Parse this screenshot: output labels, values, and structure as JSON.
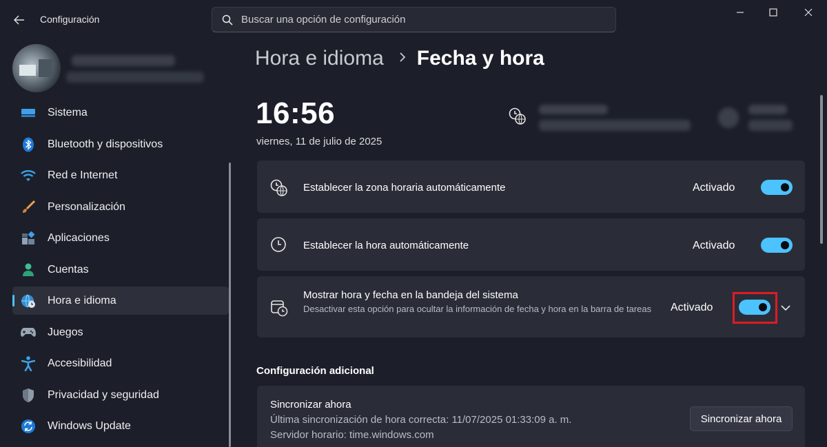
{
  "window": {
    "title": "Configuración",
    "search_placeholder": "Buscar una opción de configuración"
  },
  "sidebar": {
    "items": [
      {
        "label": "Sistema",
        "icon": "monitor-icon"
      },
      {
        "label": "Bluetooth y dispositivos",
        "icon": "bluetooth-icon"
      },
      {
        "label": "Red e Internet",
        "icon": "wifi-icon"
      },
      {
        "label": "Personalización",
        "icon": "paintbrush-icon"
      },
      {
        "label": "Aplicaciones",
        "icon": "apps-icon"
      },
      {
        "label": "Cuentas",
        "icon": "person-icon"
      },
      {
        "label": "Hora e idioma",
        "icon": "globe-clock-icon",
        "active": true
      },
      {
        "label": "Juegos",
        "icon": "gamepad-icon"
      },
      {
        "label": "Accesibilidad",
        "icon": "accessibility-icon"
      },
      {
        "label": "Privacidad y seguridad",
        "icon": "shield-icon"
      },
      {
        "label": "Windows Update",
        "icon": "update-icon"
      }
    ]
  },
  "breadcrumb": {
    "parent": "Hora e idioma",
    "current": "Fecha y hora"
  },
  "clock": {
    "time": "16:56",
    "date": "viernes, 11 de julio de 2025"
  },
  "settings": [
    {
      "title": "Establecer la zona horaria automáticamente",
      "state": "Activado",
      "on": true,
      "icon": "globe-clock-icon"
    },
    {
      "title": "Establecer la hora automáticamente",
      "state": "Activado",
      "on": true,
      "icon": "clock-icon"
    },
    {
      "title": "Mostrar hora y fecha en la bandeja del sistema",
      "description": "Desactivar esta opción para ocultar la información de fecha y hora en la barra de tareas",
      "state": "Activado",
      "on": true,
      "icon": "calendar-clock-icon"
    }
  ],
  "additional": {
    "section_title": "Configuración adicional",
    "sync_title": "Sincronizar ahora",
    "last_sync": "Última sincronización de hora correcta: 11/07/2025 01:33:09 a. m.",
    "server": "Servidor horario: time.windows.com",
    "sync_button": "Sincronizar ahora"
  },
  "colors": {
    "accent": "#4cc2ff",
    "background": "#1c1f2a",
    "card": "#2a2d37",
    "highlight_box": "#e01b24"
  }
}
